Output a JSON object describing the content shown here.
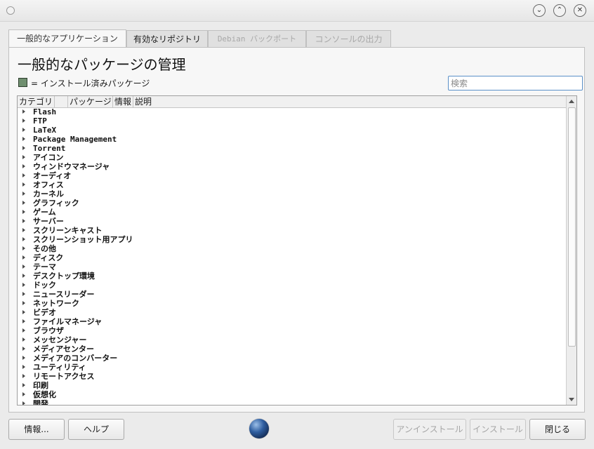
{
  "window": {
    "controls": [
      {
        "name": "minimize-button",
        "glyph": "⌄"
      },
      {
        "name": "maximize-button",
        "glyph": "⌃"
      },
      {
        "name": "close-window-button",
        "glyph": "✕"
      }
    ]
  },
  "tabs": [
    {
      "label": "一般的なアプリケーション",
      "state": "active"
    },
    {
      "label": "有効なリポジトリ",
      "state": "normal"
    },
    {
      "label": "Debian バックポート",
      "state": "disabled"
    },
    {
      "label": "コンソールの出力",
      "state": "disabled"
    }
  ],
  "main": {
    "title": "一般的なパッケージの管理",
    "legend_text": "= インストール済みパッケージ",
    "legend_color": "#6f8f6f",
    "search_placeholder": "検索"
  },
  "tree": {
    "columns": [
      "カテゴリ",
      "",
      "パッケージ",
      "情報",
      "説明"
    ],
    "categories": [
      "Flash",
      "FTP",
      "LaTeX",
      "Package Management",
      "Torrent",
      "アイコン",
      "ウィンドウマネージャ",
      "オーディオ",
      "オフィス",
      "カーネル",
      "グラフィック",
      "ゲーム",
      "サーバー",
      "スクリーンキャスト",
      "スクリーンショット用アプリ",
      "その他",
      "ディスク",
      "テーマ",
      "デスクトップ環境",
      "ドック",
      "ニュースリーダー",
      "ネットワーク",
      "ビデオ",
      "ファイルマネージャ",
      "ブラウザ",
      "メッセンジャー",
      "メディアセンター",
      "メディアのコンバーター",
      "ユーティリティ",
      "リモートアクセス",
      "印刷",
      "仮想化",
      "開発"
    ]
  },
  "buttons": {
    "about": "情報...",
    "help": "ヘルプ",
    "uninstall": "アンインストール",
    "install": "インストール",
    "close": "閉じる"
  }
}
